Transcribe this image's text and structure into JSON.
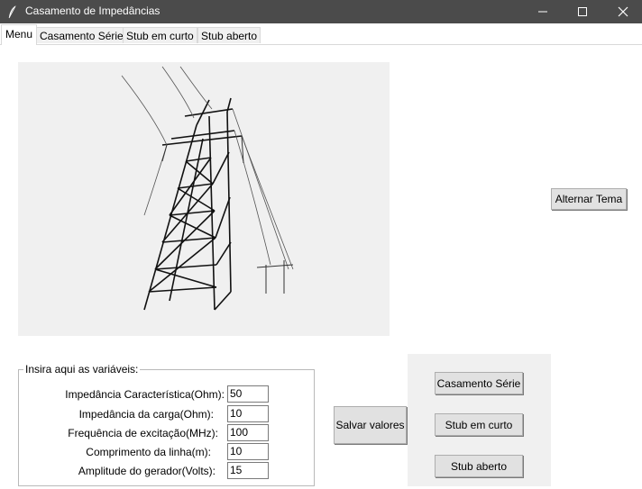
{
  "window": {
    "title": "Casamento de Impedâncias",
    "icons": [
      "feather-icon",
      "minimize-icon",
      "maximize-icon",
      "close-icon"
    ]
  },
  "tabs": [
    {
      "label": "Menu",
      "active": true
    },
    {
      "label": "Casamento Série",
      "active": false
    },
    {
      "label": "Stub em curto",
      "active": false
    },
    {
      "label": "Stub aberto",
      "active": false
    }
  ],
  "theme_button": {
    "label": "Alternar Tema"
  },
  "variables": {
    "legend": "Insira aqui as variáveis:",
    "fields": [
      {
        "label": "Impedância Característica(Ohm):",
        "value": "50"
      },
      {
        "label": "Impedância da carga(Ohm):",
        "value": "10"
      },
      {
        "label": "Frequência de excitação(MHz):",
        "value": "100"
      },
      {
        "label": "Comprimento da linha(m):",
        "value": "10"
      },
      {
        "label": "Amplitude do gerador(Volts):",
        "value": "15"
      }
    ]
  },
  "save_button": {
    "label": "Salvar valores"
  },
  "nav_buttons": [
    {
      "label": "Casamento Série"
    },
    {
      "label": "Stub em curto"
    },
    {
      "label": "Stub aberto"
    }
  ],
  "colors": {
    "titlebar": "#4b4b4b",
    "panel": "#f0f0f0",
    "button": "#e1e1e1"
  }
}
